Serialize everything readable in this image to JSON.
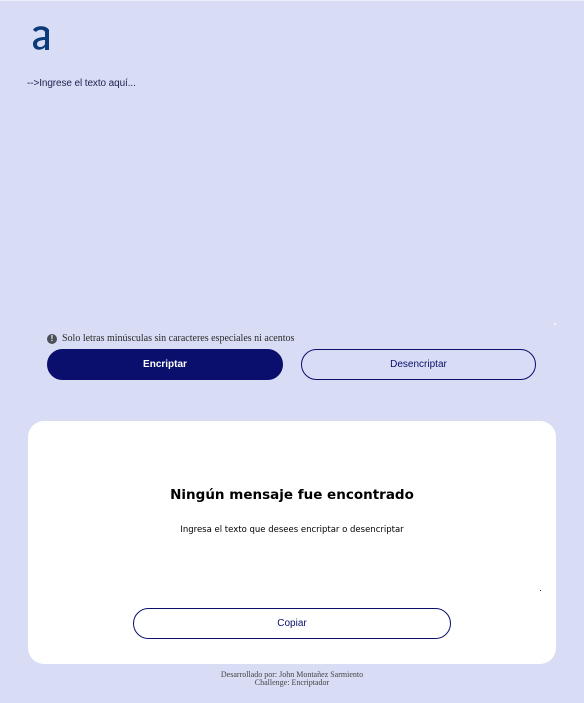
{
  "brand": {
    "logo_icon": "alura-a-logo",
    "logo_color": "#0a3a7a"
  },
  "input": {
    "placeholder": "-->Ingrese el texto aquí...",
    "value": ""
  },
  "notice": {
    "icon": "info-circle-icon",
    "text": "Solo letras minúsculas sin caracteres especiales ni acentos"
  },
  "actions": {
    "encrypt_label": "Encriptar",
    "decrypt_label": "Desencriptar"
  },
  "output": {
    "title": "Ningún mensaje fue encontrado",
    "subtitle": "Ingresa el texto que desees encriptar o desencriptar",
    "copy_label": "Copiar"
  },
  "footer": {
    "line1": "Desarrollado por: John Montañez Sarmiento",
    "line2": "Challenge: Encriptador"
  },
  "colors": {
    "background": "#d8dcf4",
    "primary": "#0a0f6e",
    "card": "#ffffff"
  }
}
